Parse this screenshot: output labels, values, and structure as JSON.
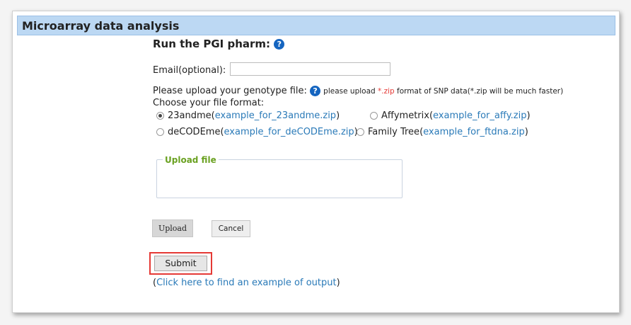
{
  "header": {
    "title": "Microarray data analysis"
  },
  "form": {
    "title": "Run the PGI pharm:",
    "help_glyph": "?",
    "email": {
      "label": "Email(optional):",
      "value": "",
      "placeholder": ""
    },
    "upload_prompt": {
      "text": "Please upload your genotype file:",
      "note_prefix": "please upload ",
      "note_ext": "*.zip",
      "note_suffix": " format of SNP data(*.zip will be much faster)"
    },
    "choose_label": "Choose your file format:",
    "formats": [
      {
        "label": "23andme",
        "link": "example_for_23andme.zip",
        "selected": true
      },
      {
        "label": "Affymetrix",
        "link": "example_for_affy.zip",
        "selected": false
      },
      {
        "label": "deCODEme",
        "link": "example_for_deCODEme.zip",
        "selected": false
      },
      {
        "label": "Family Tree",
        "link": "example_for_ftdna.zip",
        "selected": false
      }
    ],
    "upload_file_legend": "Upload file",
    "upload_button": "Upload",
    "cancel_button": "Cancel",
    "submit_button": "Submit",
    "example_output": {
      "open": "(",
      "link": "Click here to find an example of output",
      "close": ")"
    }
  },
  "colors": {
    "header_bg": "#bcd8f3",
    "link": "#2a7ab8",
    "legend": "#6aa121",
    "highlight": "#e53935",
    "help_icon": "#1565c0"
  }
}
